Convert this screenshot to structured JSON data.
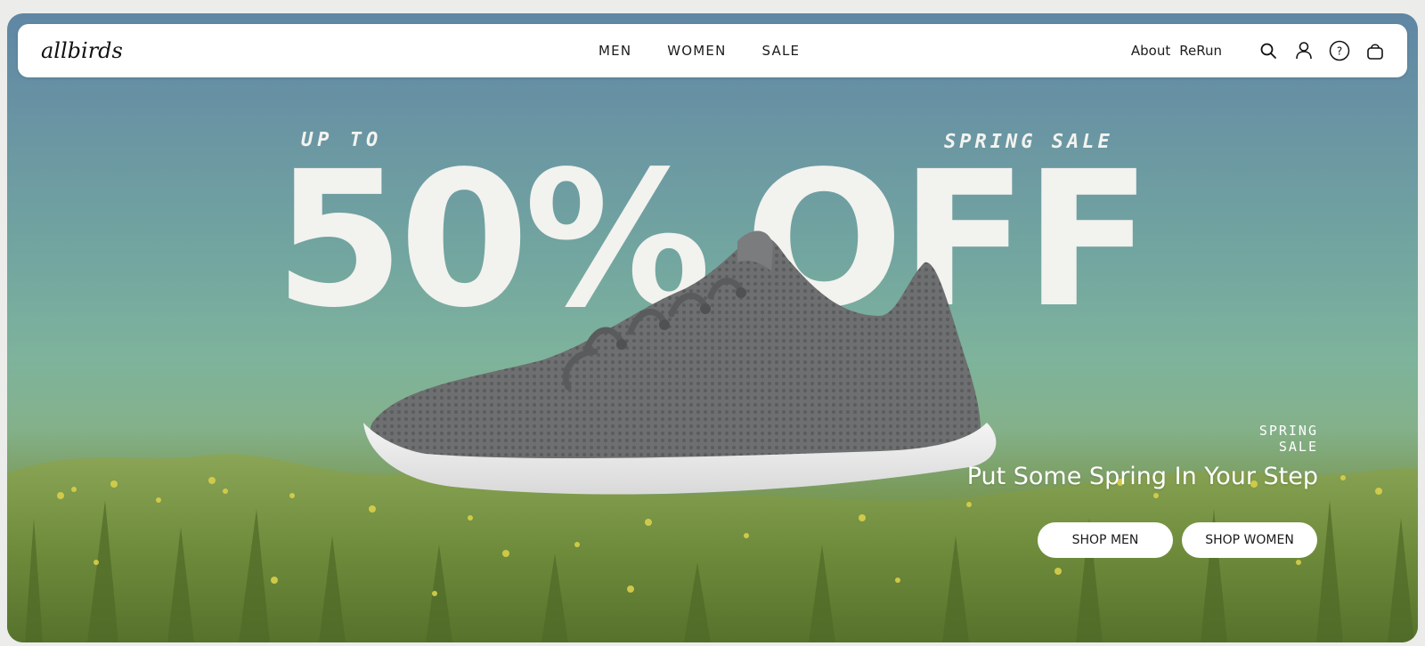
{
  "brand": {
    "logo_text": "allbirds"
  },
  "nav": {
    "center_links": [
      {
        "label": "MEN"
      },
      {
        "label": "WOMEN"
      },
      {
        "label": "SALE"
      }
    ],
    "about_label": "About",
    "rerun_label": "ReRun",
    "icons": [
      "search-icon",
      "account-icon",
      "help-icon",
      "cart-icon"
    ]
  },
  "hero": {
    "kicker_left": "UP TO",
    "kicker_right": "SPRING SALE",
    "big_left": "50%",
    "big_right": "OFF",
    "promo_tag": "SPRING SALE",
    "headline": "Put Some Spring In Your Step",
    "cta_men": "SHOP MEN",
    "cta_women": "SHOP WOMEN"
  },
  "colors": {
    "sky_top": "#5f86a4",
    "sky_bottom": "#7eb39c",
    "grass": "#6c8a3d",
    "text_light": "#f2f2ee",
    "nav_bg": "#ffffff"
  }
}
